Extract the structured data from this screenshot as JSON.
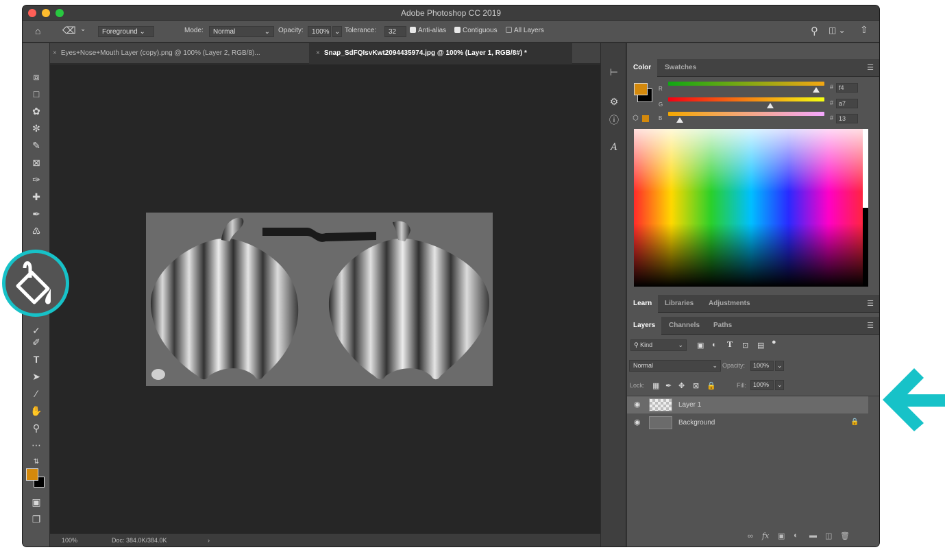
{
  "window": {
    "title": "Adobe Photoshop CC 2019"
  },
  "options_bar": {
    "fill_source": "Foreground",
    "mode_label": "Mode:",
    "mode_value": "Normal",
    "opacity_label": "Opacity:",
    "opacity_value": "100%",
    "tolerance_label": "Tolerance:",
    "tolerance_value": "32",
    "anti_alias_label": "Anti-alias",
    "contiguous_label": "Contiguous",
    "all_layers_label": "All Layers"
  },
  "document_tabs": [
    {
      "label": "Eyes+Nose+Mouth Layer (copy).png @ 100% (Layer 2, RGB/8)...",
      "active": false
    },
    {
      "label": "Snap_SdFQIsvKwt2094435974.jpg @ 100% (Layer 1, RGB/8#) *",
      "active": true
    }
  ],
  "status_bar": {
    "zoom": "100%",
    "doc": "Doc: 384.0K/384.0K",
    "arrow": "›"
  },
  "color_panel": {
    "tabs": [
      "Color",
      "Swatches"
    ],
    "foreground": "#f4a713",
    "hex": {
      "r": "f4",
      "g": "a7",
      "b": "13"
    },
    "channel_labels": {
      "r": "R",
      "g": "G",
      "b": "B"
    },
    "hash": "#",
    "levels": {
      "r": 0.957,
      "g": 0.655,
      "b": 0.075
    }
  },
  "learn_panel": {
    "tabs": [
      "Learn",
      "Libraries",
      "Adjustments"
    ]
  },
  "layers_panel": {
    "tabs": [
      "Layers",
      "Channels",
      "Paths"
    ],
    "filter_kind": "Kind",
    "blend_mode": "Normal",
    "opacity_label": "Opacity:",
    "opacity_value": "100%",
    "lock_label": "Lock:",
    "fill_label": "Fill:",
    "fill_value": "100%",
    "layers": [
      {
        "name": "Layer 1",
        "selected": true
      },
      {
        "name": "Background",
        "selected": false
      }
    ]
  },
  "colors": {
    "accent_overlay": "#17c2c8",
    "foreground_swatch": "#d4890c",
    "canvas_bg": "#262626",
    "panel_bg": "#535353"
  }
}
